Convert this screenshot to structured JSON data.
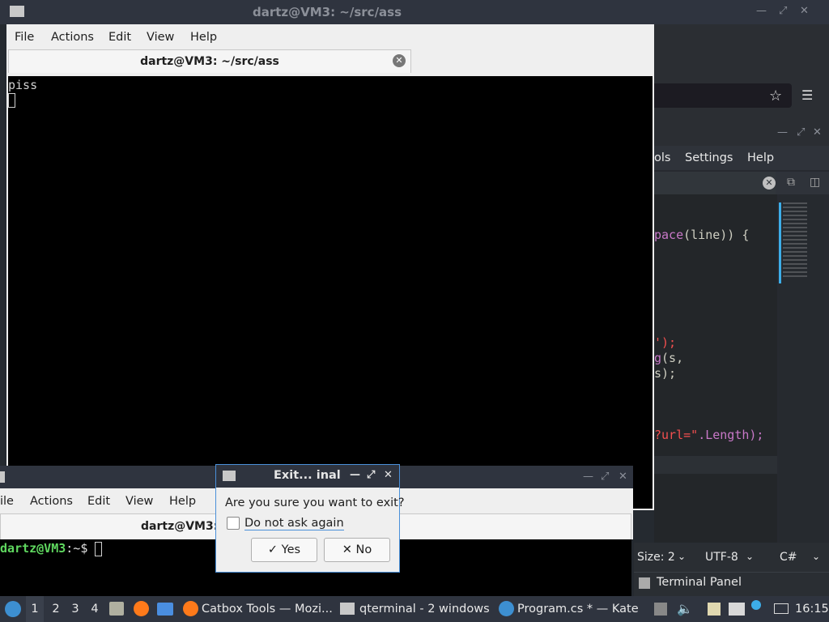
{
  "main_terminal": {
    "window_title": "dartz@VM3: ~/src/ass",
    "menu": [
      "File",
      "Actions",
      "Edit",
      "View",
      "Help"
    ],
    "tab_title": "dartz@VM3: ~/src/ass",
    "output_line": "piss"
  },
  "second_terminal": {
    "menu": [
      "ile",
      "Actions",
      "Edit",
      "View",
      "Help"
    ],
    "tab_title": "dartz@VM3:",
    "prompt_user": "dartz@VM3",
    "prompt_path": ":~$"
  },
  "dialog": {
    "title": "Exit... inal",
    "message": "Are you sure you want to exit?",
    "checkbox_label": "Do not ask again",
    "yes_label": "Yes",
    "no_label": "No"
  },
  "kate": {
    "menu": [
      "ols",
      "Settings",
      "Help"
    ],
    "code_lines": {
      "l1a": "pace",
      "l1b": "(line)) {",
      "l2": "');",
      "l3a": "g",
      "l3b": "(s,",
      "l4": "s);",
      "l5a": "?url=\"",
      "l5b": ".Length);"
    },
    "status": {
      "size": "Size: 2",
      "encoding": "UTF-8",
      "language": "C#"
    },
    "terminal_panel": "Terminal Panel"
  },
  "taskbar": {
    "workspaces": [
      "1",
      "2",
      "3",
      "4"
    ],
    "tasks": [
      {
        "label": "Catbox Tools — Mozi...",
        "icon": "firefox-icon"
      },
      {
        "label": "qterminal - 2 windows",
        "icon": "terminal-icon"
      },
      {
        "label": "Program.cs * — Kate",
        "icon": "kate-icon"
      }
    ],
    "clock": "16:15"
  },
  "colors": {
    "titlebar": "#2f343f",
    "terminal_bg": "#000000",
    "prompt_green": "#5fd75f",
    "dialog_border": "#4a90d9"
  }
}
